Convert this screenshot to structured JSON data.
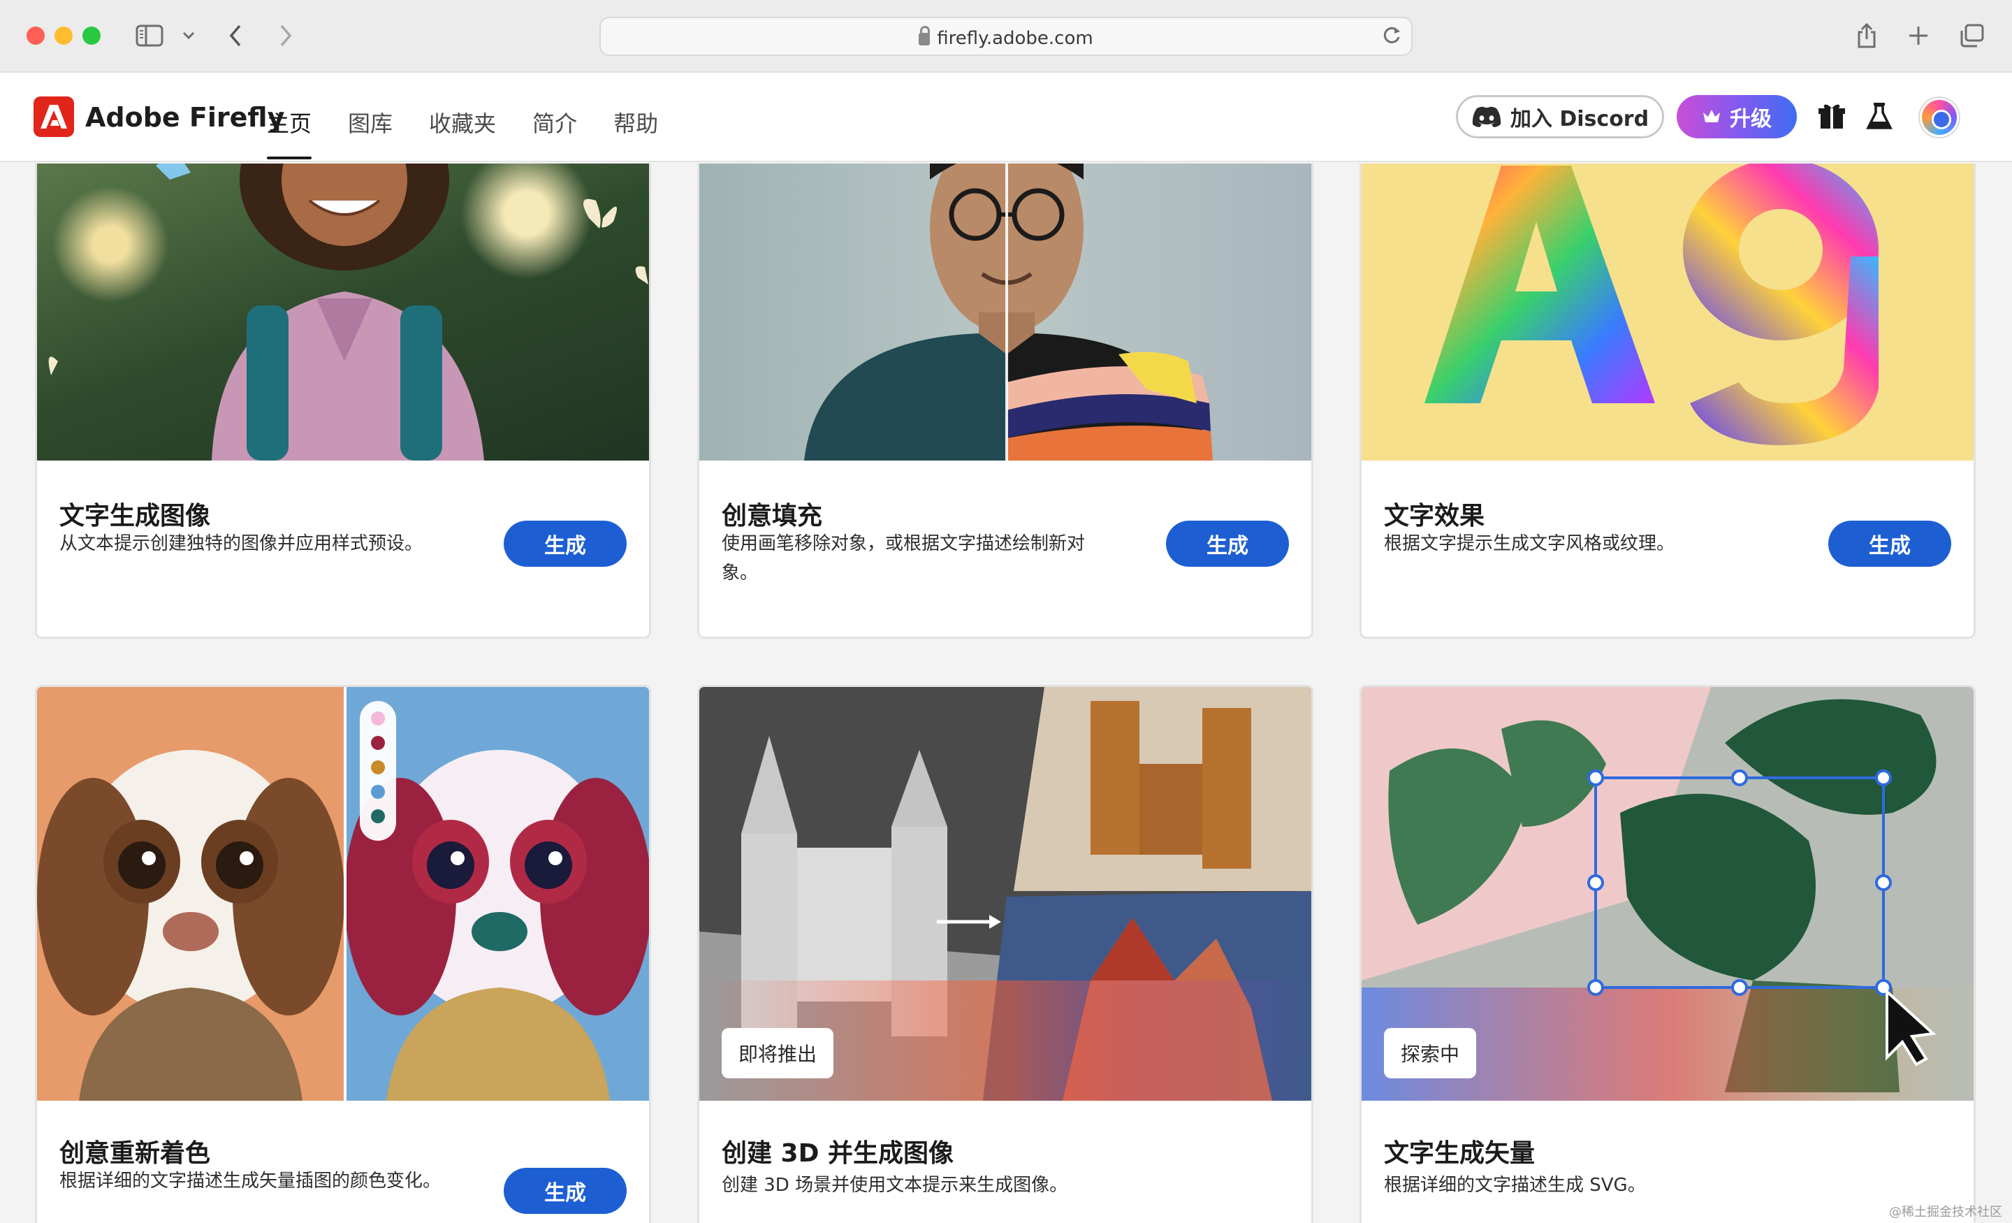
{
  "browser": {
    "url": "firefly.adobe.com"
  },
  "header": {
    "brand": "Adobe Firefly",
    "nav": [
      {
        "label": "主页",
        "active": true
      },
      {
        "label": "图库",
        "active": false
      },
      {
        "label": "收藏夹",
        "active": false
      },
      {
        "label": "简介",
        "active": false
      },
      {
        "label": "帮助",
        "active": false
      }
    ],
    "discord_label": "加入 Discord",
    "upgrade_label": "升级"
  },
  "cards": [
    {
      "title": "文字生成图像",
      "description": "从文本提示创建独特的图像并应用样式预设。",
      "button": "生成"
    },
    {
      "title": "创意填充",
      "description": "使用画笔移除对象，或根据文字描述绘制新对象。",
      "button": "生成"
    },
    {
      "title": "文字效果",
      "description": "根据文字提示生成文字风格或纹理。",
      "button": "生成"
    },
    {
      "title": "创意重新着色",
      "description": "根据详细的文字描述生成矢量插图的颜色变化。",
      "button": "生成"
    },
    {
      "title": "创建 3D 并生成图像",
      "description": "创建 3D 场景并使用文本提示来生成图像。",
      "badge": "即将推出"
    },
    {
      "title": "文字生成矢量",
      "description": "根据详细的文字描述生成 SVG。",
      "badge": "探索中"
    }
  ],
  "colors": {
    "primary_button": "#1d5fd3",
    "brand_red": "#e1251b",
    "upgrade_gradient": [
      "#c94fd8",
      "#3f6df2"
    ]
  },
  "watermark": "@稀土掘金技术社区"
}
